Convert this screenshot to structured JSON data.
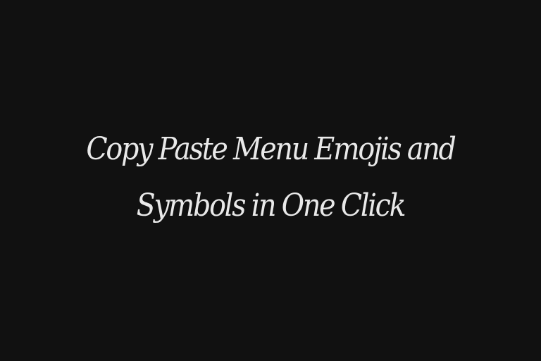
{
  "title": "Copy Paste Menu Emojis and Symbols in One Click",
  "colors": {
    "background": "#111111",
    "text": "#e9e9e9"
  }
}
